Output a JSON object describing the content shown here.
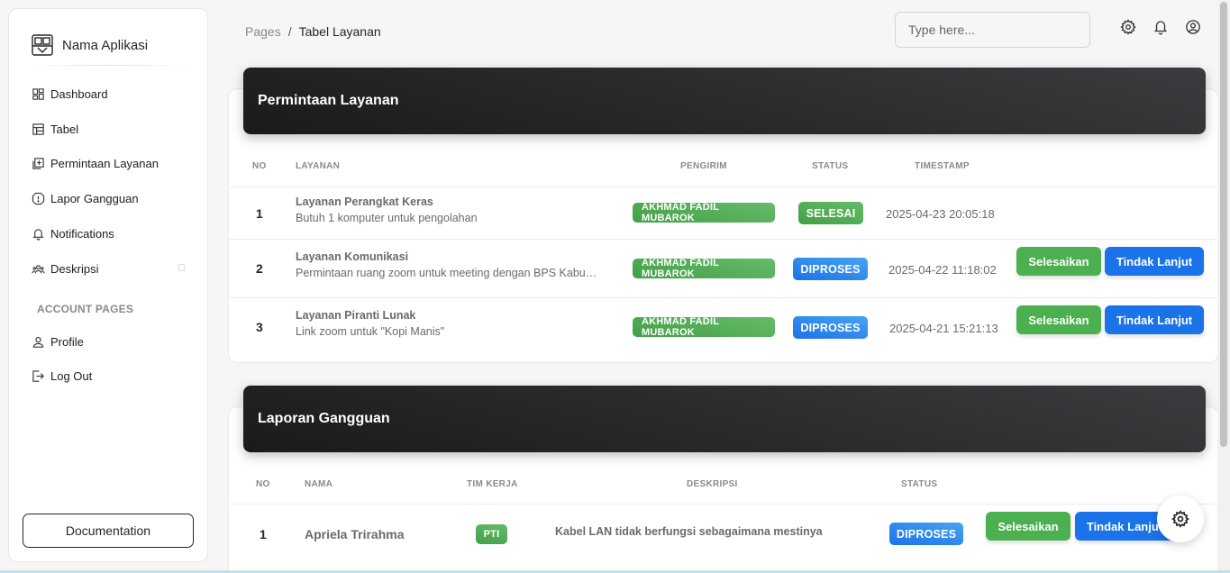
{
  "sidebar": {
    "brand": "Nama Aplikasi",
    "items": [
      {
        "label": "Dashboard"
      },
      {
        "label": "Tabel"
      },
      {
        "label": "Permintaan Layanan"
      },
      {
        "label": "Lapor Gangguan"
      },
      {
        "label": "Notifications"
      },
      {
        "label": "Deskripsi"
      }
    ],
    "section": "ACCOUNT PAGES",
    "account_items": [
      {
        "label": "Profile"
      },
      {
        "label": "Log Out"
      }
    ],
    "documentation": "Documentation"
  },
  "header": {
    "breadcrumb_parent": "Pages",
    "breadcrumb_sep": "/",
    "breadcrumb_current": "Tabel Layanan",
    "search_placeholder": "Type here..."
  },
  "requests": {
    "title": "Permintaan Layanan",
    "columns": {
      "no": "NO",
      "layanan": "LAYANAN",
      "pengirim": "PENGIRIM",
      "status": "STATUS",
      "timestamp": "TIMESTAMP"
    },
    "rows": [
      {
        "no": "1",
        "title": "Layanan Perangkat Keras",
        "desc": "Butuh 1 komputer untuk pengolahan",
        "sender": "AKHMAD FADIL MUBAROK",
        "status": "SELESAI",
        "timestamp": "2025-04-23 20:05:18"
      },
      {
        "no": "2",
        "title": "Layanan Komunikasi",
        "desc": "Permintaan ruang zoom untuk meeting dengan BPS Kabupaten",
        "sender": "AKHMAD FADIL MUBAROK",
        "status": "DIPROSES",
        "timestamp": "2025-04-22 11:18:02",
        "btn_done": "Selesaikan",
        "btn_follow": "Tindak Lanjut"
      },
      {
        "no": "3",
        "title": "Layanan Piranti Lunak",
        "desc": "Link zoom untuk \"Kopi Manis\"",
        "sender": "AKHMAD FADIL MUBAROK",
        "status": "DIPROSES",
        "timestamp": "2025-04-21 15:21:13",
        "btn_done": "Selesaikan",
        "btn_follow": "Tindak Lanjut"
      }
    ]
  },
  "reports": {
    "title": "Laporan Gangguan",
    "columns": {
      "no": "NO",
      "nama": "NAMA",
      "tim": "TIM KERJA",
      "deskripsi": "DESKRIPSI",
      "status": "STATUS"
    },
    "rows": [
      {
        "no": "1",
        "name": "Apriela Trirahma",
        "team": "PTI",
        "desc": "Kabel LAN tidak berfungsi sebagaimana mestinya",
        "status": "DIPROSES",
        "btn_done": "Selesaikan",
        "btn_follow": "Tindak Lanjut"
      }
    ]
  },
  "icons": {
    "brand": "logo-icon",
    "settings": "gear-icon",
    "notifications": "bell-icon",
    "account": "user-circle-icon"
  },
  "colors": {
    "success": "#4caf50",
    "info": "#1a73e8",
    "header_dark": "#1a1a1a"
  }
}
